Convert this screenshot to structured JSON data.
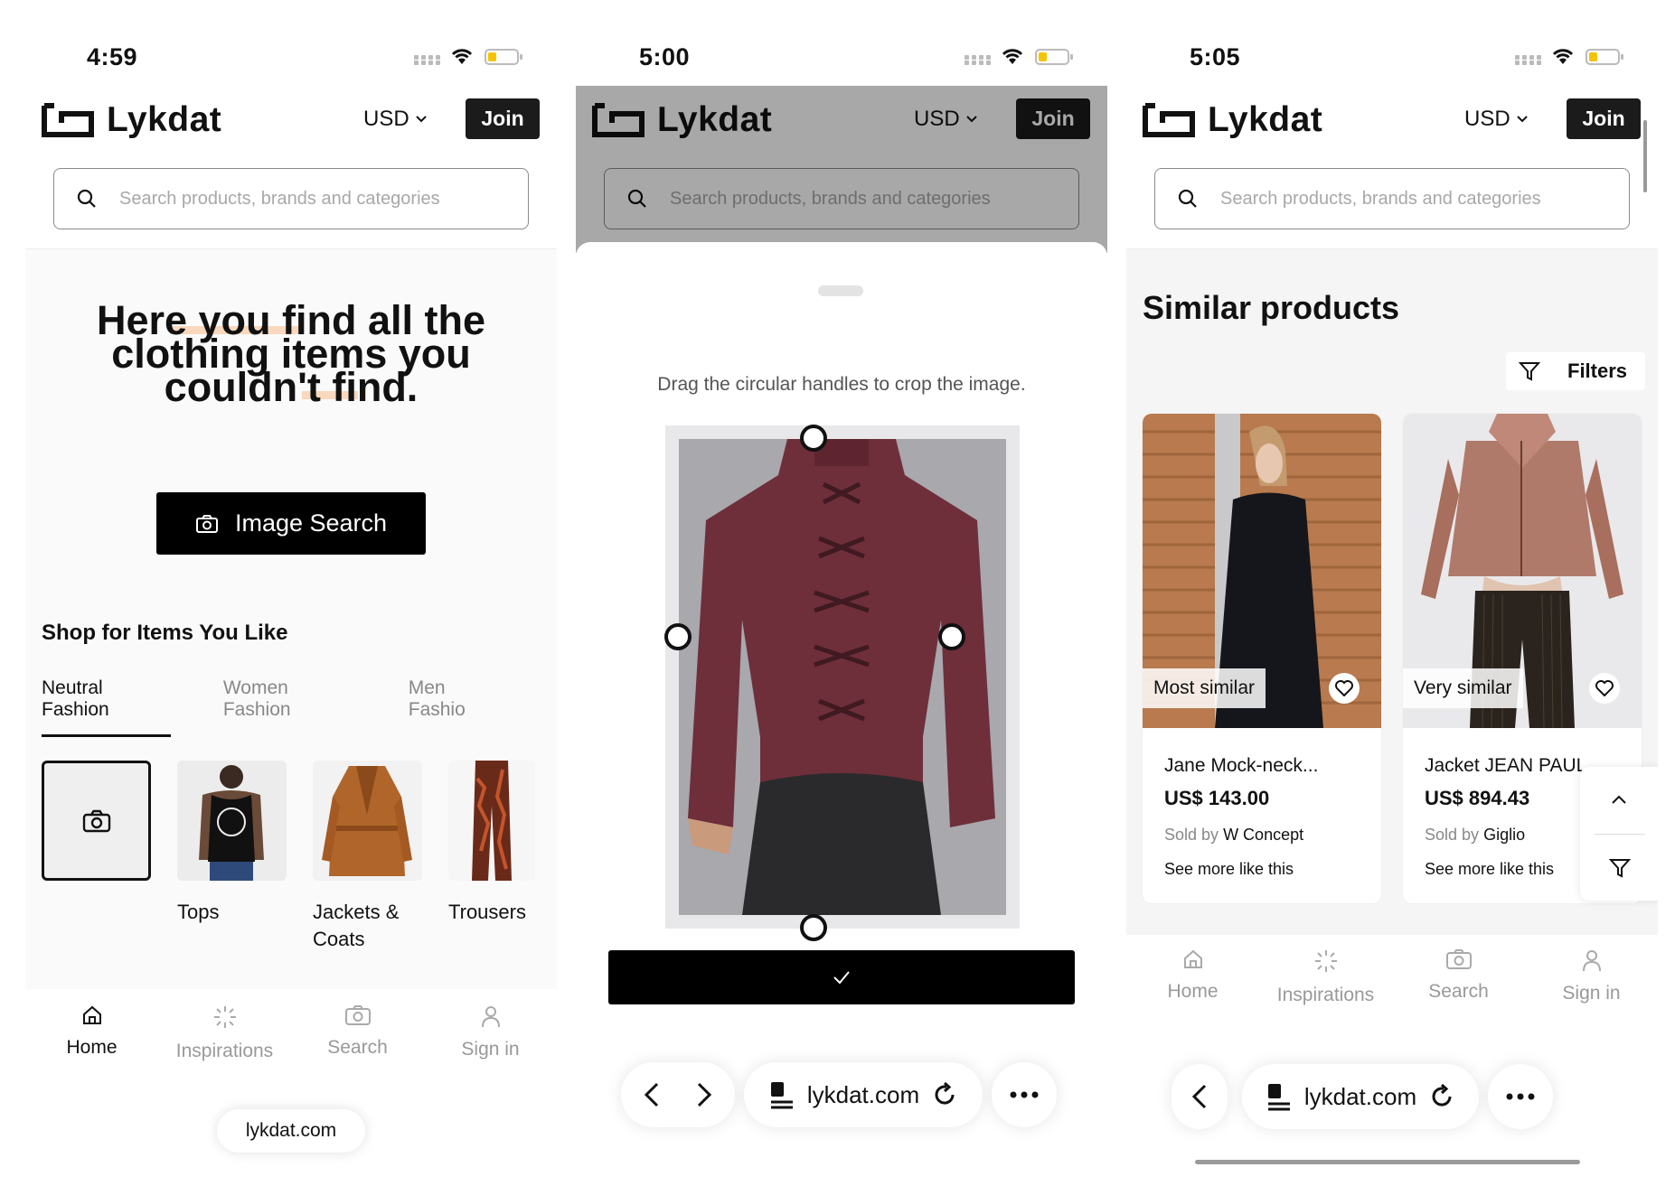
{
  "screens": [
    {
      "status_time": "4:59",
      "brand": "Lykdat",
      "currency": "USD",
      "join_label": "Join",
      "search_placeholder": "Search products, brands and categories",
      "hero_line1": "Here you find all the",
      "hero_line2": "clothing items you",
      "hero_line3": "couldn't find.",
      "image_search_label": "Image Search",
      "shop_title": "Shop for Items You Like",
      "tabs": [
        "Neutral Fashion",
        "Women Fashion",
        "Men Fashio"
      ],
      "categories": [
        {
          "label": "",
          "icon": "camera-icon"
        },
        {
          "label": "Tops"
        },
        {
          "label": "Jackets & Coats"
        },
        {
          "label": "Trousers"
        }
      ],
      "nav": [
        {
          "label": "Home",
          "icon": "home-icon",
          "active": true
        },
        {
          "label": "Inspirations",
          "icon": "sparkle-icon"
        },
        {
          "label": "Search",
          "icon": "camera-icon"
        },
        {
          "label": "Sign in",
          "icon": "user-icon"
        }
      ],
      "url": "lykdat.com"
    },
    {
      "status_time": "5:00",
      "brand": "Lykdat",
      "currency": "USD",
      "join_label": "Join",
      "search_placeholder": "Search products, brands and categories",
      "crop_hint": "Drag the circular handles to crop the image.",
      "confirm_icon": "check-icon",
      "url": "lykdat.com"
    },
    {
      "status_time": "5:05",
      "brand": "Lykdat",
      "currency": "USD",
      "join_label": "Join",
      "search_placeholder": "Search products, brands and categories",
      "section_title": "Similar products",
      "filters_label": "Filters",
      "products": [
        {
          "tag": "Most similar",
          "name": "Jane Mock-neck...",
          "price": "US$ 143.00",
          "sold_by_label": "Sold by",
          "seller": "W Concept",
          "more": "See more like this"
        },
        {
          "tag": "Very similar",
          "name": "Jacket JEAN PAUL",
          "price": "US$ 894.43",
          "sold_by_label": "Sold by",
          "seller": "Giglio",
          "more": "See more like this"
        }
      ],
      "nav": [
        {
          "label": "Home",
          "icon": "home-icon"
        },
        {
          "label": "Inspirations",
          "icon": "sparkle-icon"
        },
        {
          "label": "Search",
          "icon": "camera-icon"
        },
        {
          "label": "Sign in",
          "icon": "user-icon"
        }
      ],
      "url": "lykdat.com"
    }
  ],
  "colors": {
    "accent_highlight": "#f9d8bd",
    "dark": "#1b1b1b",
    "battery": "#f5c400"
  }
}
